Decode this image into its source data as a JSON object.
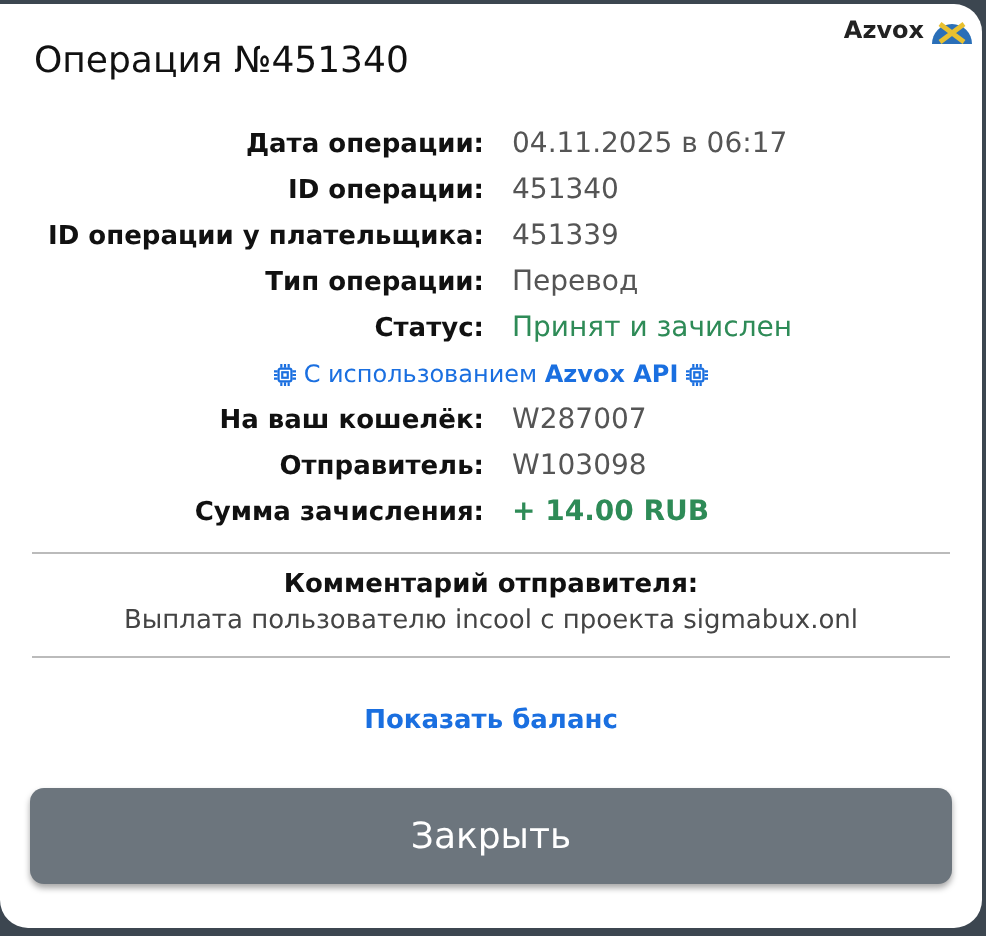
{
  "brand": {
    "name": "Azvox"
  },
  "title": "Операция №451340",
  "rows": [
    {
      "label": "Дата операции:",
      "value": "04.11.2025 в 06:17",
      "kind": "plain"
    },
    {
      "label": "ID операции:",
      "value": "451340",
      "kind": "plain"
    },
    {
      "label": "ID операции у плательщика:",
      "value": "451339",
      "kind": "plain"
    },
    {
      "label": "Тип операции:",
      "value": "Перевод",
      "kind": "plain"
    },
    {
      "label": "Статус:",
      "value": "Принят и зачислен",
      "kind": "success"
    }
  ],
  "api_note": "С использованием **Azvox API**",
  "rows_2": [
    {
      "label": "На ваш кошелёк:",
      "value": "W287007",
      "kind": "plain"
    },
    {
      "label": "Отправитель:",
      "value": "W103098",
      "kind": "plain"
    },
    {
      "label": "Сумма зачисления:",
      "value": "+ 14.00 RUB",
      "kind": "amount"
    }
  ],
  "comment": {
    "heading": "Комментарий отправителя:",
    "text": "Выплата пользователю incool с проекта sigmabux.onl"
  },
  "link": "Показать баланс",
  "buttons": [
    "Закрыть"
  ]
}
